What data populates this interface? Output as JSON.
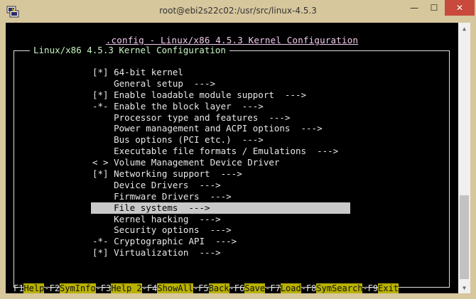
{
  "window": {
    "title": "root@ebi2s22c02:/usr/src/linux-4.5.3",
    "min_glyph": "—",
    "max_glyph": "☐",
    "close_glyph": "✕"
  },
  "menuconfig": {
    "config_title": ".config - Linux/x86 4.5.3 Kernel Configuration",
    "frame_title": "Linux/x86 4.5.3 Kernel Configuration",
    "items": [
      "[*] 64-bit kernel",
      "    General setup  --->",
      "[*] Enable loadable module support  --->",
      "-*- Enable the block layer  --->",
      "    Processor type and features  --->",
      "    Power management and ACPI options  --->",
      "    Bus options (PCI etc.)  --->",
      "    Executable file formats / Emulations  --->",
      "< > Volume Management Device Driver",
      "[*] Networking support  --->",
      "    Device Drivers  --->",
      "    Firmware Drivers  --->",
      "    File systems  --->",
      "    Kernel hacking  --->",
      "    Security options  --->",
      "-*- Cryptographic API  --->",
      "[*] Virtualization  --->"
    ],
    "selected_index": 12
  },
  "fkeys": [
    {
      "key": "F1",
      "label": "Help"
    },
    {
      "key": "F2",
      "label": "SymInfo"
    },
    {
      "key": "F3",
      "label": "Help 2"
    },
    {
      "key": "F4",
      "label": "ShowAll"
    },
    {
      "key": "F5",
      "label": "Back"
    },
    {
      "key": "F6",
      "label": "Save"
    },
    {
      "key": "F7",
      "label": "Load"
    },
    {
      "key": "F8",
      "label": "SymSearch"
    },
    {
      "key": "F9",
      "label": "Exit"
    }
  ],
  "colors": {
    "terminal_bg": "#000000",
    "highlight": "#c9c9c9",
    "fkey_label_bg": "#b8b100",
    "frame_title": "#c9f5c4",
    "config_title": "#f0cbec"
  },
  "icons": {
    "app": "putty-icon",
    "scroll_up": "scroll-up-arrow-icon",
    "scroll_down": "scroll-down-arrow-icon"
  }
}
